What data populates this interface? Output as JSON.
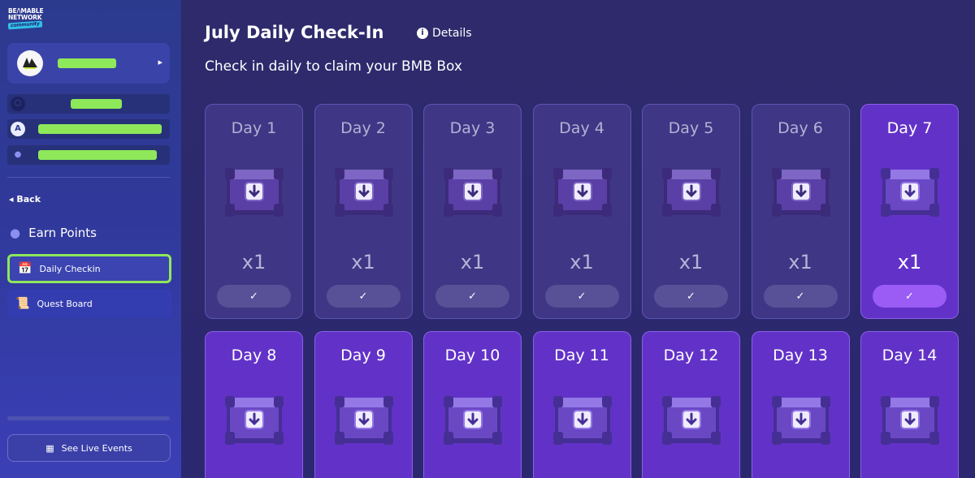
{
  "sidebar": {
    "logo": {
      "line1": "BE/\\MABLE",
      "line2": "NETWORK",
      "tag": "community"
    },
    "profile": {
      "avatar_icon": "avatar-badge-icon",
      "name": "",
      "arrow_icon": "chevron-right-icon"
    },
    "stats": [
      {
        "icon": "hexagon-token-icon",
        "value": ""
      },
      {
        "icon": "arbitrum-icon",
        "value": ""
      },
      {
        "icon": "points-icon",
        "value": ""
      }
    ],
    "back_label": "Back",
    "section_title": "Earn Points",
    "nav": [
      {
        "label": "Daily Checkin",
        "icon": "calendar-icon",
        "active": true
      },
      {
        "label": "Quest Board",
        "icon": "scroll-icon",
        "active": false
      }
    ],
    "live_events_label": "See Live Events"
  },
  "main": {
    "title": "July Daily Check-In",
    "details_label": "Details",
    "subtitle": "Check in daily to claim your BMB Box"
  },
  "days": [
    {
      "label": "Day 1",
      "qty": "x1",
      "state": "claimed"
    },
    {
      "label": "Day 2",
      "qty": "x1",
      "state": "claimed"
    },
    {
      "label": "Day 3",
      "qty": "x1",
      "state": "claimed"
    },
    {
      "label": "Day 4",
      "qty": "x1",
      "state": "claimed"
    },
    {
      "label": "Day 5",
      "qty": "x1",
      "state": "claimed"
    },
    {
      "label": "Day 6",
      "qty": "x1",
      "state": "claimed"
    },
    {
      "label": "Day 7",
      "qty": "x1",
      "state": "today"
    },
    {
      "label": "Day 8",
      "qty": "",
      "state": "future"
    },
    {
      "label": "Day 9",
      "qty": "",
      "state": "future"
    },
    {
      "label": "Day 10",
      "qty": "",
      "state": "future"
    },
    {
      "label": "Day 11",
      "qty": "",
      "state": "future"
    },
    {
      "label": "Day 12",
      "qty": "",
      "state": "future"
    },
    {
      "label": "Day 13",
      "qty": "",
      "state": "future"
    },
    {
      "label": "Day 14",
      "qty": "",
      "state": "future"
    }
  ],
  "colors": {
    "accent_green": "#8ee85a",
    "card_claimed": "#3f3785",
    "card_active": "#6232c8",
    "check_active": "#9a5cf4"
  }
}
